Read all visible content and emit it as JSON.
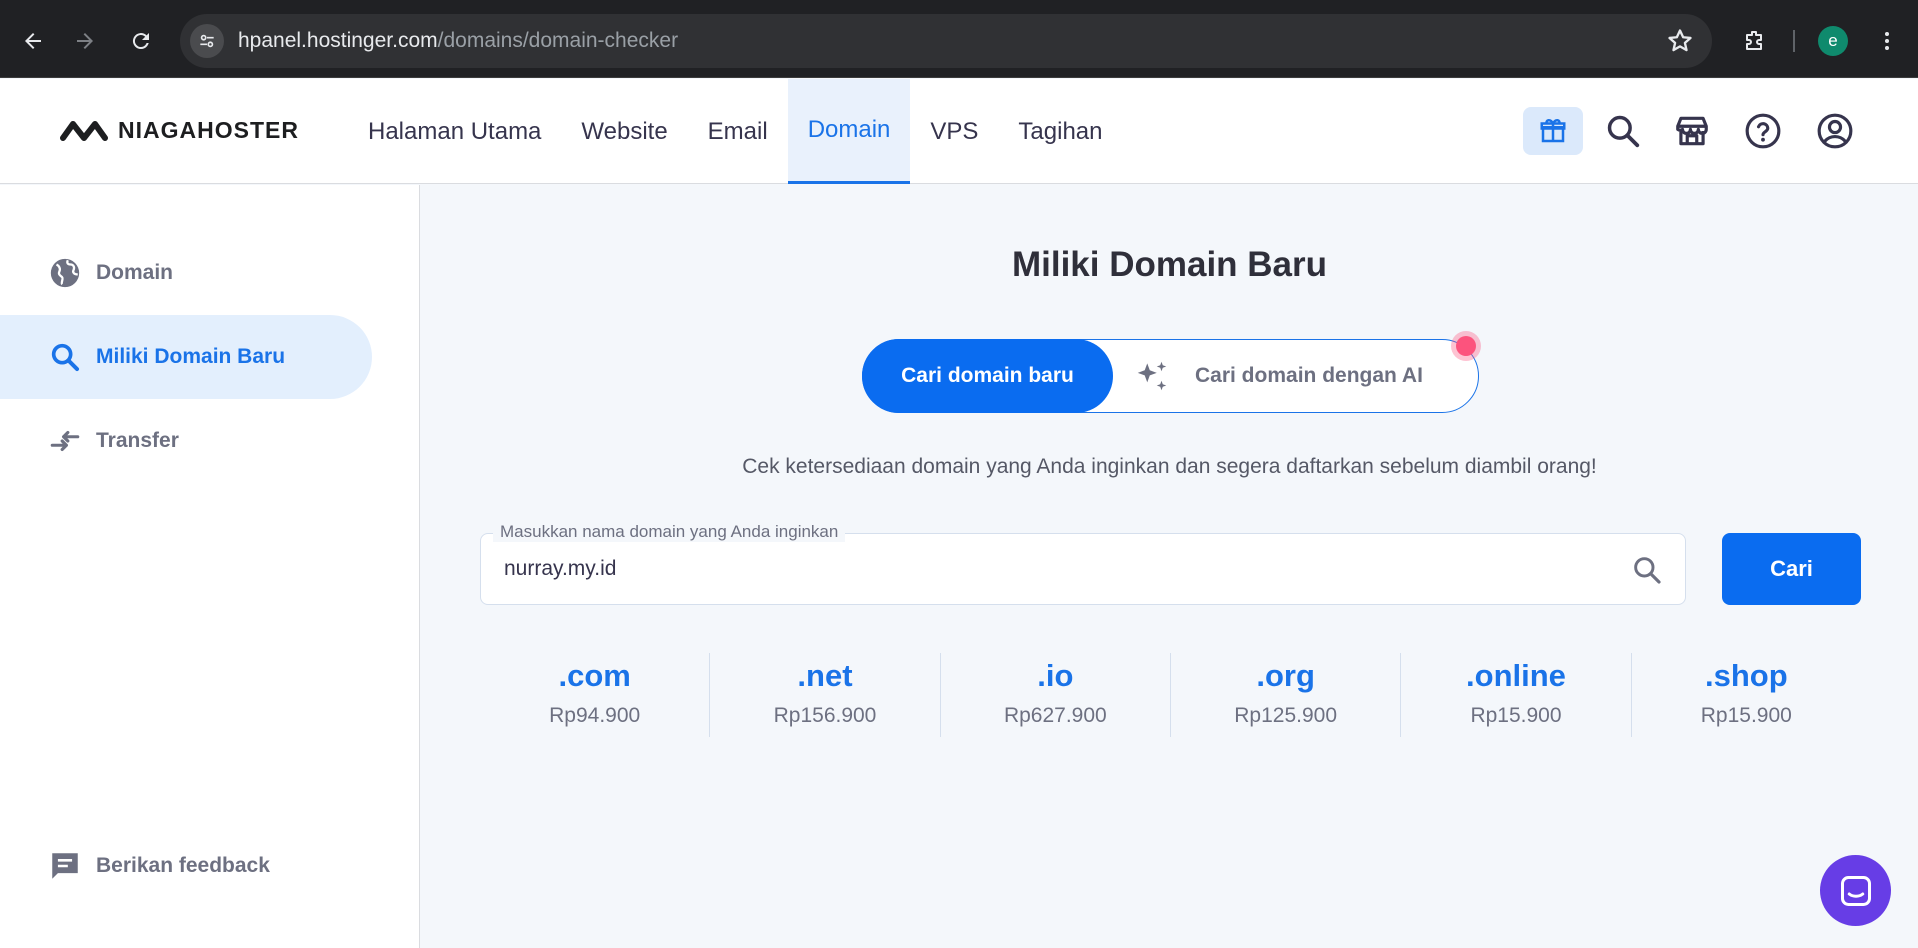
{
  "browser": {
    "url_host": "hpanel.hostinger.com",
    "url_path": "/domains/domain-checker",
    "profile_initial": "e"
  },
  "header": {
    "logo_text": "NIAGAHOSTER",
    "nav": [
      {
        "label": "Halaman Utama",
        "active": false
      },
      {
        "label": "Website",
        "active": false
      },
      {
        "label": "Email",
        "active": false
      },
      {
        "label": "Domain",
        "active": true
      },
      {
        "label": "VPS",
        "active": false
      },
      {
        "label": "Tagihan",
        "active": false
      }
    ],
    "icons": [
      "gift-icon",
      "search-icon",
      "store-icon",
      "help-icon",
      "account-icon"
    ]
  },
  "sidebar": {
    "items": [
      {
        "label": "Domain",
        "icon": "globe-icon",
        "active": false
      },
      {
        "label": "Miliki Domain Baru",
        "icon": "search-icon",
        "active": true
      },
      {
        "label": "Transfer",
        "icon": "transfer-icon",
        "active": false
      }
    ],
    "feedback_label": "Berikan feedback"
  },
  "main": {
    "title": "Miliki Domain Baru",
    "mode_active_label": "Cari domain baru",
    "mode_ai_label": "Cari domain dengan AI",
    "subtitle": "Cek ketersediaan domain yang Anda inginkan dan segera daftarkan sebelum diambil orang!",
    "search_label": "Masukkan nama domain yang Anda inginkan",
    "search_value": "nurray.my.id",
    "search_button": "Cari",
    "tlds": [
      {
        "name": ".com",
        "price": "Rp94.900"
      },
      {
        "name": ".net",
        "price": "Rp156.900"
      },
      {
        "name": ".io",
        "price": "Rp627.900"
      },
      {
        "name": ".org",
        "price": "Rp125.900"
      },
      {
        "name": ".online",
        "price": "Rp15.900"
      },
      {
        "name": ".shop",
        "price": "Rp15.900"
      }
    ]
  },
  "colors": {
    "primary": "#0a6cf0",
    "chat": "#673de6",
    "notification": "#fc537d"
  }
}
